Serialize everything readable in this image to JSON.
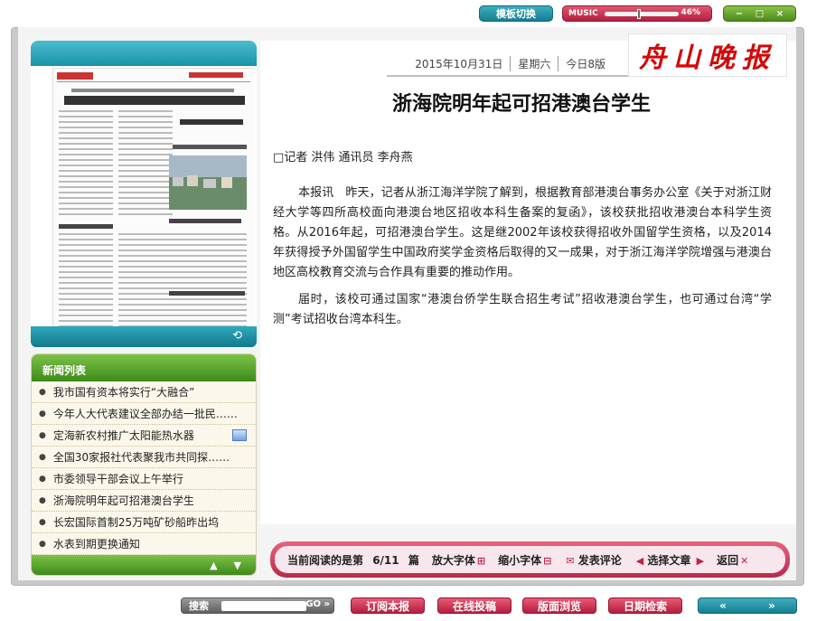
{
  "top": {
    "template_switch_label": "模板切换",
    "music_label": "MUSIC",
    "music_level": 0.46,
    "music_percent_text": "46%",
    "window_controls": [
      "−",
      "□",
      "×"
    ]
  },
  "header": {
    "date": "2015年10月31日",
    "weekday": "星期六",
    "edition": "今日8版",
    "logo_text": "舟山晚报"
  },
  "article": {
    "headline": "浙海院明年起可招港澳台学生",
    "byline": "□记者 洪伟 通讯员 李舟燕",
    "paragraphs": [
      "本报讯　昨天，记者从浙江海洋学院了解到，根据教育部港澳台事务办公室《关于对浙江财经大学等四所高校面向港澳台地区招收本科生备案的复函》，该校获批招收港澳台本科学生资格。从2016年起，可招港澳台学生。这是继2002年该校获得招收外国留学生资格，以及2014年获得授予外国留学生中国政府奖学金资格后取得的又一成果，对于浙江海洋学院增强与港澳台地区高校教育交流与合作具有重要的推动作用。",
      "届时，该校可通过国家“港澳台侨学生联合招生考试”招收港澳台学生，也可通过台湾“学测”考试招收台湾本科生。"
    ]
  },
  "sidebar": {
    "news_list_title": "新闻列表",
    "items": [
      {
        "label": "我市国有资本将实行“大融合”",
        "has_image": false
      },
      {
        "label": "今年人大代表建议全部办结一批民……",
        "has_image": false
      },
      {
        "label": "定海新农村推广太阳能热水器",
        "has_image": true
      },
      {
        "label": "全国30家报社代表聚我市共同探……",
        "has_image": false
      },
      {
        "label": "市委领导干部会议上午举行",
        "has_image": false
      },
      {
        "label": "浙海院明年起可招港澳台学生",
        "has_image": false
      },
      {
        "label": "长宏国际首制25万吨矿砂船昨出坞",
        "has_image": false
      },
      {
        "label": "水表到期更换通知",
        "has_image": false
      }
    ]
  },
  "reading_bar": {
    "current_label": "当前阅读的是第",
    "current_page": "6/11",
    "page_unit": "篇",
    "enlarge_font": "放大字体",
    "shrink_font": "缩小字体",
    "comment": "发表评论",
    "select_article": "选择文章",
    "back": "返回"
  },
  "bottom_bar": {
    "search_label": "搜索",
    "go_label": "GO",
    "subscribe": "订阅本报",
    "submit_online": "在线投稿",
    "layout_browse": "版面浏览",
    "date_search": "日期检索"
  },
  "colors": {
    "accent_teal": "#1993a8",
    "accent_green": "#4c8a1c",
    "accent_red": "#b8294b",
    "logo_red": "#d10a0a"
  }
}
